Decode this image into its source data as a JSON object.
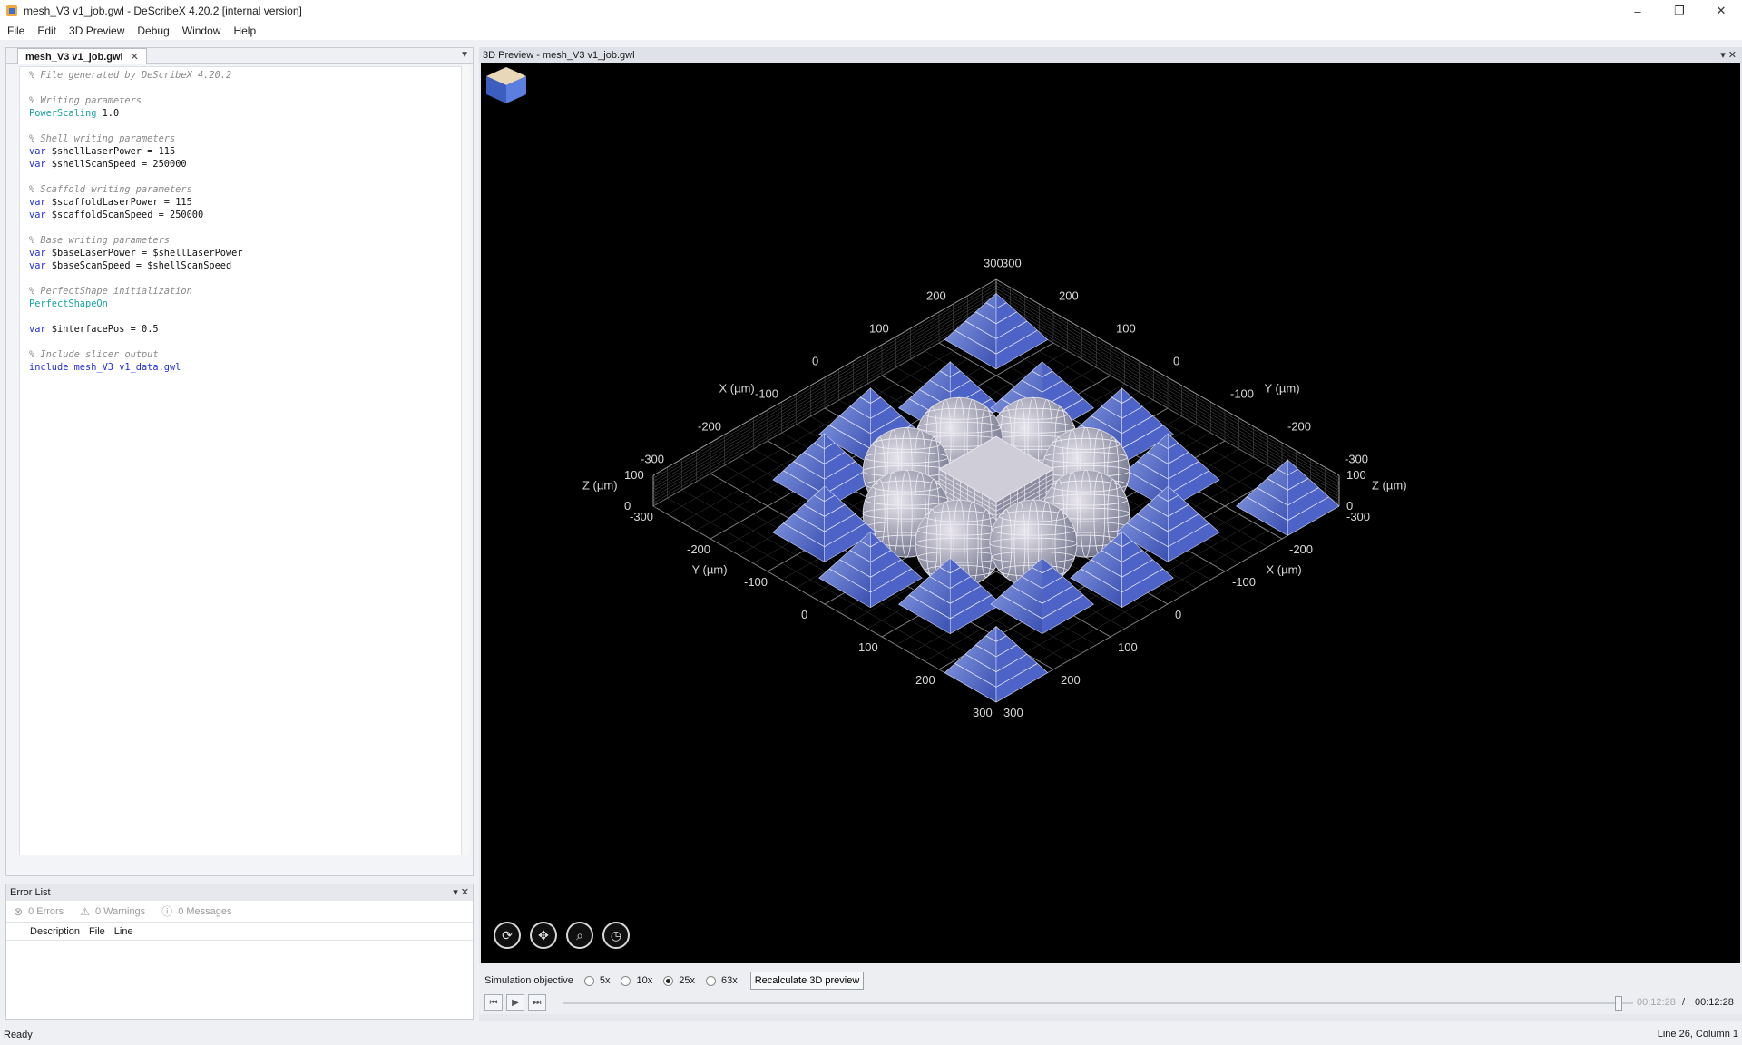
{
  "window": {
    "title": "mesh_V3 v1_job.gwl - DeScribeX 4.20.2 [internal version]",
    "controls": [
      "–",
      "❐",
      "✕"
    ]
  },
  "menu": [
    "File",
    "Edit",
    "3D Preview",
    "Debug",
    "Window",
    "Help"
  ],
  "editor": {
    "tab_label": "mesh_V3 v1_job.gwl",
    "tab_close": "✕",
    "pin": "▼",
    "lines": [
      [
        {
          "t": "% File generated by DeScribeX 4.20.2",
          "c": "comment"
        }
      ],
      [],
      [
        {
          "t": "% Writing parameters",
          "c": "comment"
        }
      ],
      [
        {
          "t": "PowerScaling",
          "c": "func"
        },
        {
          "t": " 1.0",
          "c": "plain"
        }
      ],
      [],
      [
        {
          "t": "% Shell writing parameters",
          "c": "comment"
        }
      ],
      [
        {
          "t": "var",
          "c": "kw"
        },
        {
          "t": " $shellLaserPower = 115",
          "c": "plain"
        }
      ],
      [
        {
          "t": "var",
          "c": "kw"
        },
        {
          "t": " $shellScanSpeed = 250000",
          "c": "plain"
        }
      ],
      [],
      [
        {
          "t": "% Scaffold writing parameters",
          "c": "comment"
        }
      ],
      [
        {
          "t": "var",
          "c": "kw"
        },
        {
          "t": " $scaffoldLaserPower = 115",
          "c": "plain"
        }
      ],
      [
        {
          "t": "var",
          "c": "kw"
        },
        {
          "t": " $scaffoldScanSpeed = 250000",
          "c": "plain"
        }
      ],
      [],
      [
        {
          "t": "% Base writing parameters",
          "c": "comment"
        }
      ],
      [
        {
          "t": "var",
          "c": "kw"
        },
        {
          "t": " $baseLaserPower = $shellLaserPower",
          "c": "plain"
        }
      ],
      [
        {
          "t": "var",
          "c": "kw"
        },
        {
          "t": " $baseScanSpeed = $shellScanSpeed",
          "c": "plain"
        }
      ],
      [],
      [
        {
          "t": "% PerfectShape initialization",
          "c": "comment"
        }
      ],
      [
        {
          "t": "PerfectShapeOn",
          "c": "func"
        }
      ],
      [],
      [
        {
          "t": "var",
          "c": "kw"
        },
        {
          "t": " $interfacePos = 0.5",
          "c": "plain"
        }
      ],
      [],
      [
        {
          "t": "% Include slicer output",
          "c": "comment"
        }
      ],
      [
        {
          "t": "include mesh_V3 v1_data.gwl",
          "c": "include"
        }
      ]
    ]
  },
  "error_list": {
    "title": "Error List",
    "controls": "▾ ✕",
    "errors": "0 Errors",
    "warnings": "0 Warnings",
    "messages": "0 Messages",
    "columns": [
      "Description",
      "File",
      "Line"
    ]
  },
  "preview": {
    "title": "3D Preview - mesh_V3 v1_job.gwl",
    "controls": "▾ ✕",
    "axis_labels": {
      "x": "X (µm)",
      "y": "Y (µm)",
      "z": "Z (µm)"
    },
    "ticks": {
      "xy": [
        "300",
        "200",
        "100",
        "0",
        "-100",
        "-200",
        "-300"
      ],
      "z": [
        "100",
        "0"
      ]
    },
    "objects": {
      "pyramids": 15,
      "spheres": 8,
      "cubes": 1
    }
  },
  "simulation": {
    "label": "Simulation objective",
    "objectives": [
      "5x",
      "10x",
      "25x",
      "63x"
    ],
    "selected": "25x",
    "recalc_label": "Recalculate 3D preview",
    "time_current": "00:12:28",
    "time_sep": "/",
    "time_total": "00:12:28",
    "progress": 1.0
  },
  "status": {
    "left": "Ready",
    "right": "Line 26, Column 1"
  },
  "colors": {
    "accent": "#2030e0",
    "viewport_bg": "#000000"
  }
}
